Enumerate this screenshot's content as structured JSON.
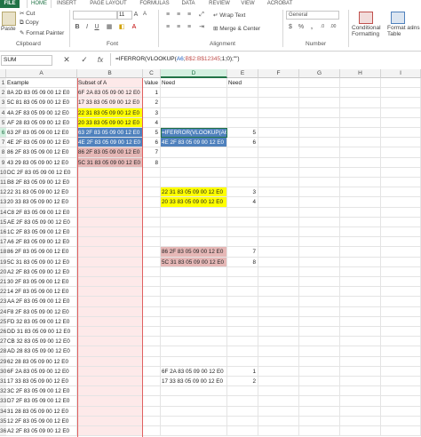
{
  "tabs": [
    "FILE",
    "HOME",
    "INSERT",
    "PAGE LAYOUT",
    "FORMULAS",
    "DATA",
    "REVIEW",
    "VIEW",
    "ACROBAT"
  ],
  "ribbon": {
    "cut": "Cut",
    "copy": "Copy",
    "paste": "Paste",
    "format_painter": "Format Painter",
    "clipboard": "Clipboard",
    "font_size": "11",
    "font_group": "Font",
    "bold": "B",
    "italic": "I",
    "underline": "U",
    "wrap_text": "Wrap Text",
    "merge_center": "Merge & Center",
    "alignment": "Alignment",
    "number_format": "General",
    "currency": "$",
    "percent": "%",
    "comma": ",",
    "number": "Number",
    "conditional_formatting": "Conditional\nFormatting",
    "format_as_table": "Format as\nTable",
    "insert_label": "Ins"
  },
  "formula_bar": {
    "name_box": "SUM",
    "cancel": "✕",
    "enter": "✓",
    "fx": "fx",
    "formula_prefix": "=IFERROR(VLOOKUP(",
    "formula_a6": "A6",
    "formula_comma1": ";",
    "formula_range": "B$2:B$12345",
    "formula_suffix": ";1;0);\"\")"
  },
  "columns": [
    "A",
    "B",
    "C",
    "D",
    "E",
    "F",
    "G",
    "H",
    "I"
  ],
  "rows": [
    {
      "n": "1",
      "a": "Example",
      "b": "Subset of A",
      "c": "Value",
      "d": "Need",
      "e": "Need"
    },
    {
      "n": "2",
      "a": "8A 2D 83 05 09 00 12 E0",
      "b": "6F 2A 83 05 09 00 12 E0",
      "c": "1"
    },
    {
      "n": "3",
      "a": "5C 81 83 05 09 00 12 E0",
      "b": "17 33 83 05 09 00 12 E0",
      "c": "2"
    },
    {
      "n": "4",
      "a": "4A 2F 83 05 09 00 12 E0",
      "b": "22 31 83 05 09 00 12 E0",
      "c": "3",
      "bb": "y"
    },
    {
      "n": "5",
      "a": "AF 28 83 05 09 00 12 E0",
      "b": "20 33 83 05 09 00 12 E0",
      "c": "4",
      "bb": "y"
    },
    {
      "n": "6",
      "a": "63 2F 83 05 09 00 12 E0",
      "b": "63 2F 83 05 09 00 12 E0",
      "c": "5",
      "bb": "b",
      "d": "=IFERROR(VLOOKUP(A6",
      "db": "b",
      "e": "5"
    },
    {
      "n": "7",
      "a": "4E 2F 83 05 09 00 12 E0",
      "b": "4E 2F 83 05 09 00 12 E0",
      "c": "6",
      "bb": "b",
      "d": "4E 2F 83 05 09 00 12 E0",
      "db": "b",
      "e": "6"
    },
    {
      "n": "8",
      "a": "86 2F 83 05 09 00 12 E0",
      "b": "86 2F 83 05 09 00 12 E0",
      "c": "7",
      "bb": "p"
    },
    {
      "n": "9",
      "a": "43 29 83 05 09 00 12 E0",
      "b": "5C 31 83 05 09 00 12 E0",
      "c": "8",
      "bb": "p"
    },
    {
      "n": "10",
      "a": "DC 2F 83 05 09 00 12 E0"
    },
    {
      "n": "11",
      "a": "B8 2F 83 05 09 00 12 E0"
    },
    {
      "n": "12",
      "a": "22 31 83 05 09 00 12 E0",
      "d": "22 31 83 05 09 00 12 E0",
      "db": "y",
      "e": "3"
    },
    {
      "n": "13",
      "a": "20 33 83 05 09 00 12 E0",
      "d": "20 33 83 05 09 00 12 E0",
      "db": "y",
      "e": "4"
    },
    {
      "n": "14",
      "a": "C8 2F 83 05 09 00 12 E0"
    },
    {
      "n": "15",
      "a": "AE 2F 83 05 09 00 12 E0"
    },
    {
      "n": "16",
      "a": "1C 2F 83 05 09 00 12 E0"
    },
    {
      "n": "17",
      "a": "A6 2F 83 05 09 00 12 E0"
    },
    {
      "n": "18",
      "a": "86 2F 83 05 09 00 12 E0",
      "d": "86 2F 83 05 09 00 12 E0",
      "db": "p",
      "e": "7"
    },
    {
      "n": "19",
      "a": "5C 31 83 05 09 00 12 E0",
      "d": "5C 31 83 05 09 00 12 E0",
      "db": "p",
      "e": "8"
    },
    {
      "n": "20",
      "a": "A2 2F 83 05 09 00 12 E0"
    },
    {
      "n": "21",
      "a": "30 2F 83 05 09 00 12 E0"
    },
    {
      "n": "22",
      "a": "14 2F 83 05 09 00 12 E0"
    },
    {
      "n": "23",
      "a": "AA 2F 83 05 09 00 12 E0"
    },
    {
      "n": "24",
      "a": "F8 2F 83 05 09 00 12 E0"
    },
    {
      "n": "25",
      "a": "FD 32 83 05 09 00 12 E0"
    },
    {
      "n": "26",
      "a": "DD 31 83 05 09 00 12 E0"
    },
    {
      "n": "27",
      "a": "CB 32 83 05 09 00 12 E0"
    },
    {
      "n": "28",
      "a": "AD 28 83 05 09 00 12 E0"
    },
    {
      "n": "29",
      "a": "62 28 83 05 09 00 12 E0"
    },
    {
      "n": "30",
      "a": "6F 2A 83 05 09 00 12 E0",
      "d": "6F 2A 83 05 09 00 12 E0",
      "e": "1"
    },
    {
      "n": "31",
      "a": "17 33 83 05 09 00 12 E0",
      "d": "17 33 83 05 09 00 12 E0",
      "e": "2"
    },
    {
      "n": "32",
      "a": "3C 2F 83 05 09 00 12 E0"
    },
    {
      "n": "33",
      "a": "D7 2F 83 05 09 00 12 E0"
    },
    {
      "n": "34",
      "a": "31 28 83 05 09 00 12 E0"
    },
    {
      "n": "35",
      "a": "12 2F 83 05 09 00 12 E0"
    },
    {
      "n": "36",
      "a": "A2 2F 83 05 09 00 12 E0"
    }
  ],
  "colors": {
    "accent": "#217346",
    "yellow": "#ffff00",
    "blue": "#4f81bd",
    "salmon": "#e6b8b7",
    "pink": "#fde9e9",
    "formula_red": "#c0504d",
    "formula_blue": "#1f5fbf"
  }
}
